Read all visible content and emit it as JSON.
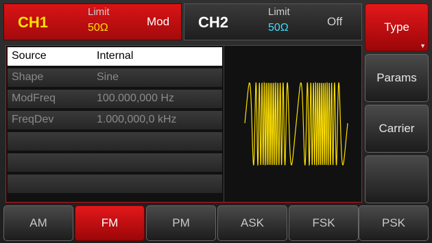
{
  "ch1": {
    "name": "CH1",
    "limit_label": "Limit",
    "impedance": "50Ω",
    "mode": "Mod"
  },
  "ch2": {
    "name": "CH2",
    "limit_label": "Limit",
    "impedance": "50Ω",
    "mode": "Off"
  },
  "softkeys": [
    {
      "label": "Type"
    },
    {
      "label": "Params"
    },
    {
      "label": "Carrier"
    },
    {
      "label": ""
    }
  ],
  "params": [
    {
      "label": "Source",
      "value": "Internal"
    },
    {
      "label": "Shape",
      "value": "Sine"
    },
    {
      "label": "ModFreq",
      "value": "100.000,000 Hz"
    },
    {
      "label": "FreqDev",
      "value": "1.000,000,0 kHz"
    },
    {
      "label": "",
      "value": ""
    },
    {
      "label": "",
      "value": ""
    },
    {
      "label": "",
      "value": ""
    }
  ],
  "modulation_tabs": [
    {
      "label": "AM"
    },
    {
      "label": "FM"
    },
    {
      "label": "PM"
    },
    {
      "label": "ASK"
    },
    {
      "label": "FSK"
    },
    {
      "label": "PSK"
    }
  ],
  "colors": {
    "accent_red": "#c5141a",
    "ch1_text": "#ffe000",
    "ch2_impedance": "#3ee0ff",
    "waveform": "#ffe000"
  }
}
